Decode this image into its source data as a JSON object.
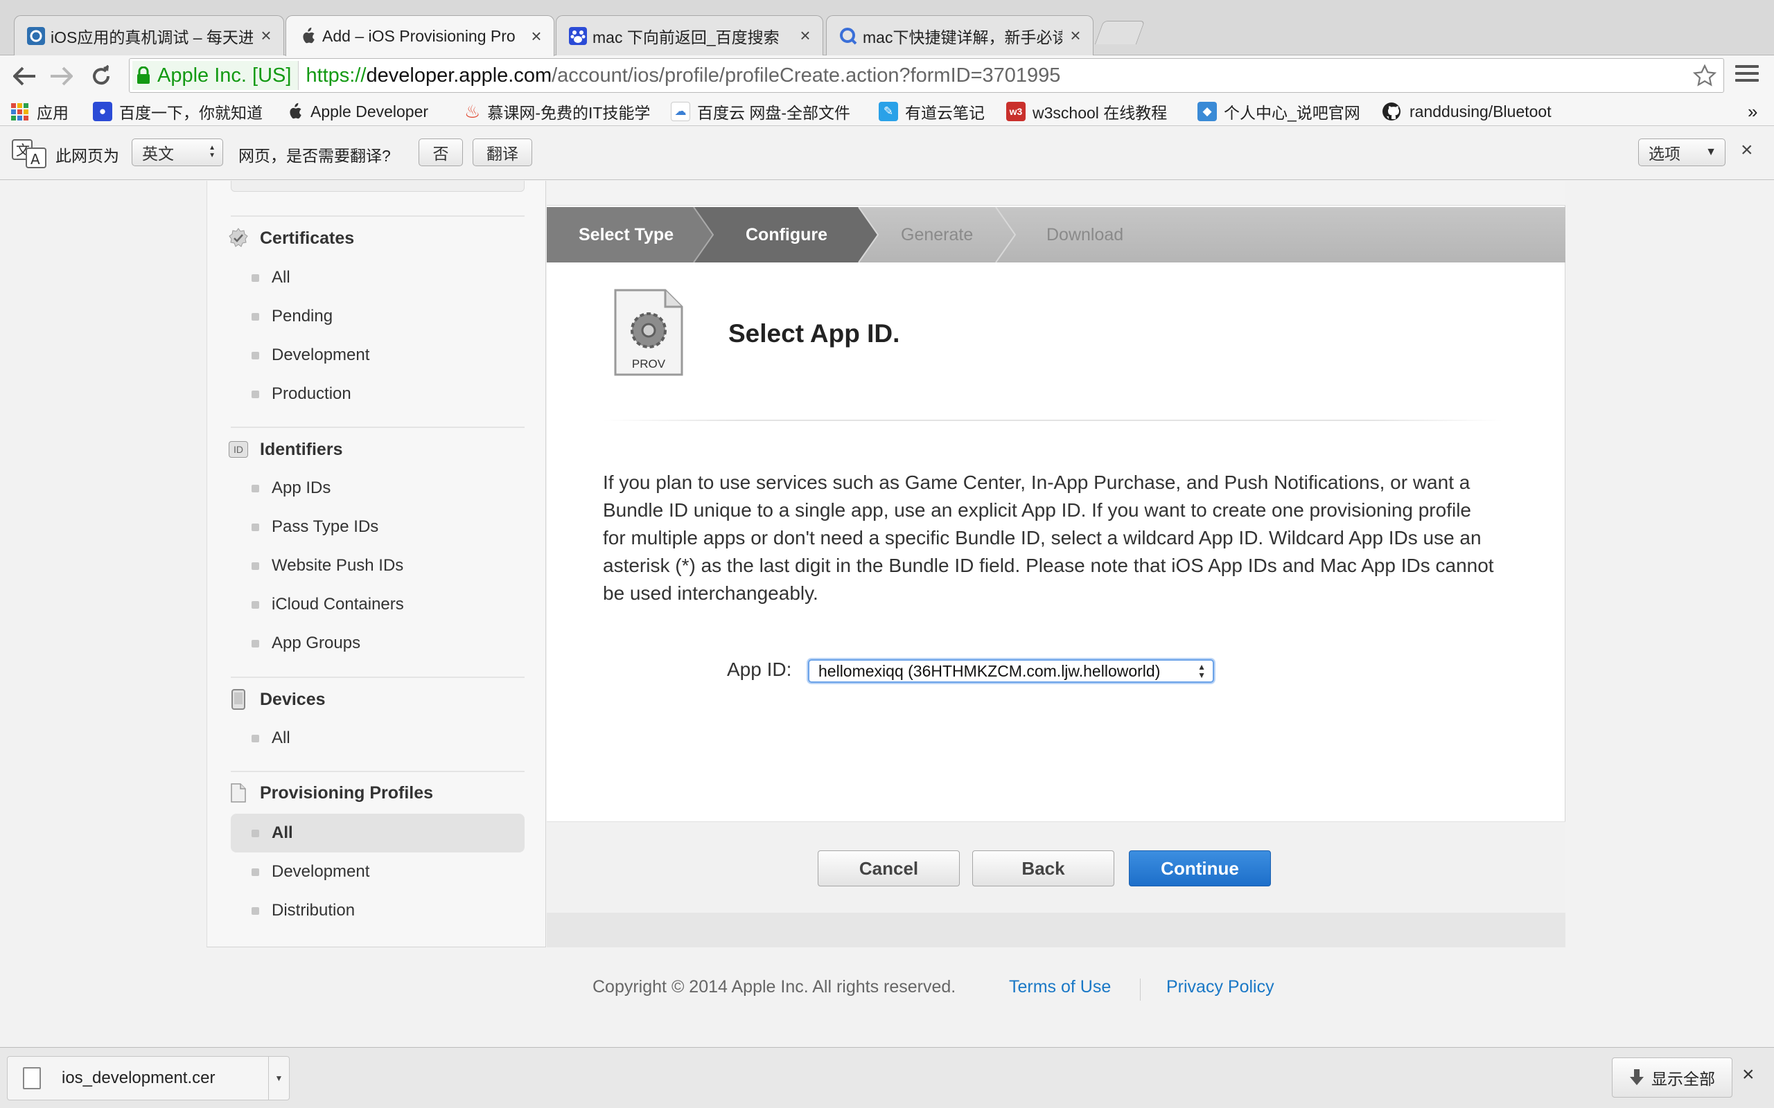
{
  "tabs": [
    {
      "title": "iOS应用的真机调试 – 每天进",
      "icon": "site-icon"
    },
    {
      "title": "Add – iOS Provisioning Pro",
      "icon": "apple-icon"
    },
    {
      "title": "mac 下向前返回_百度搜索",
      "icon": "baidu-paw-icon"
    },
    {
      "title": "mac下快捷键详解，新手必读",
      "icon": "search-q-icon"
    }
  ],
  "address": {
    "ev_label": "Apple Inc. [US]",
    "scheme": "https://",
    "host": "developer.apple.com",
    "path": "/account/ios/profile/profileCreate.action?formID=3701995"
  },
  "bookmarks": [
    {
      "label": "应用",
      "color": "#e04a3c"
    },
    {
      "label": "百度一下，你就知道",
      "color": "#2b4bd6"
    },
    {
      "label": "Apple Developer",
      "color": "#333333"
    },
    {
      "label": "慕课网-免费的IT技能学",
      "color": "#e0442c"
    },
    {
      "label": "百度云 网盘-全部文件",
      "color": "#3a7fd4"
    },
    {
      "label": "有道云笔记",
      "color": "#2aa1e8"
    },
    {
      "label": "w3school 在线教程",
      "color": "#c9302c"
    },
    {
      "label": "个人中心_说吧官网",
      "color": "#3a8ad6"
    },
    {
      "label": "randdusing/Bluetoot",
      "color": "#222222"
    }
  ],
  "translate": {
    "prefix": "此网页为",
    "language": "英文",
    "question": "网页，是否需要翻译?",
    "no": "否",
    "translate": "翻译",
    "options": "选项"
  },
  "sidebar": {
    "sections": [
      {
        "title": "Certificates",
        "items": [
          "All",
          "Pending",
          "Development",
          "Production"
        ]
      },
      {
        "title": "Identifiers",
        "items": [
          "App IDs",
          "Pass Type IDs",
          "Website Push IDs",
          "iCloud Containers",
          "App Groups"
        ]
      },
      {
        "title": "Devices",
        "items": [
          "All"
        ]
      },
      {
        "title": "Provisioning Profiles",
        "items": [
          "All",
          "Development",
          "Distribution"
        ]
      }
    ],
    "id_badge": "ID"
  },
  "steps": [
    "Select Type",
    "Configure",
    "Generate",
    "Download"
  ],
  "prov_label": "PROV",
  "main": {
    "title": "Select App ID.",
    "paragraph": "If you plan to use services such as Game Center, In-App Purchase, and Push Notifications, or want a Bundle ID unique to a single app, use an explicit App ID. If you want to create one provisioning profile for multiple apps or don't need a specific Bundle ID, select a wildcard App ID. Wildcard App IDs use an asterisk (*) as the last digit in the Bundle ID field. Please note that iOS App IDs and Mac App IDs cannot be used interchangeably.",
    "appid_label": "App ID:",
    "appid_value": "hellomexiqq (36HTHMKZCM.com.ljw.helloworld)"
  },
  "buttons": {
    "cancel": "Cancel",
    "back": "Back",
    "continue": "Continue"
  },
  "footer": {
    "copyright": "Copyright © 2014 Apple Inc. All rights reserved.",
    "terms": "Terms of Use",
    "privacy": "Privacy Policy"
  },
  "downloads": {
    "file": "ios_development.cer",
    "show_all": "显示全部"
  }
}
